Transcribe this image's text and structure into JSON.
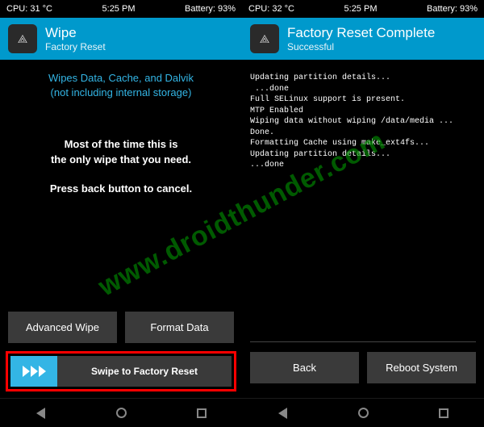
{
  "watermark": "www.droidthunder.com",
  "left": {
    "status": {
      "cpu": "CPU: 31 °C",
      "time": "5:25 PM",
      "battery": "Battery: 93%"
    },
    "header": {
      "title": "Wipe",
      "subtitle": "Factory Reset"
    },
    "desc": {
      "l1": "Wipes Data, Cache, and Dalvik",
      "l2": "(not including internal storage)",
      "b1": "Most of the time this is",
      "b2": "the only wipe that you need.",
      "b3": "Press back button to cancel."
    },
    "buttons": {
      "advanced": "Advanced Wipe",
      "format": "Format Data"
    },
    "swipe": "Swipe to Factory Reset"
  },
  "right": {
    "status": {
      "cpu": "CPU: 32 °C",
      "time": "5:25 PM",
      "battery": "Battery: 93%"
    },
    "header": {
      "title": "Factory Reset Complete",
      "subtitle": "Successful"
    },
    "log": "Updating partition details...\n ...done\nFull SELinux support is present.\nMTP Enabled\nWiping data without wiping /data/media ...\nDone.\nFormatting Cache using make_ext4fs...\nUpdating partition details...\n...done",
    "buttons": {
      "back": "Back",
      "reboot": "Reboot System"
    }
  }
}
